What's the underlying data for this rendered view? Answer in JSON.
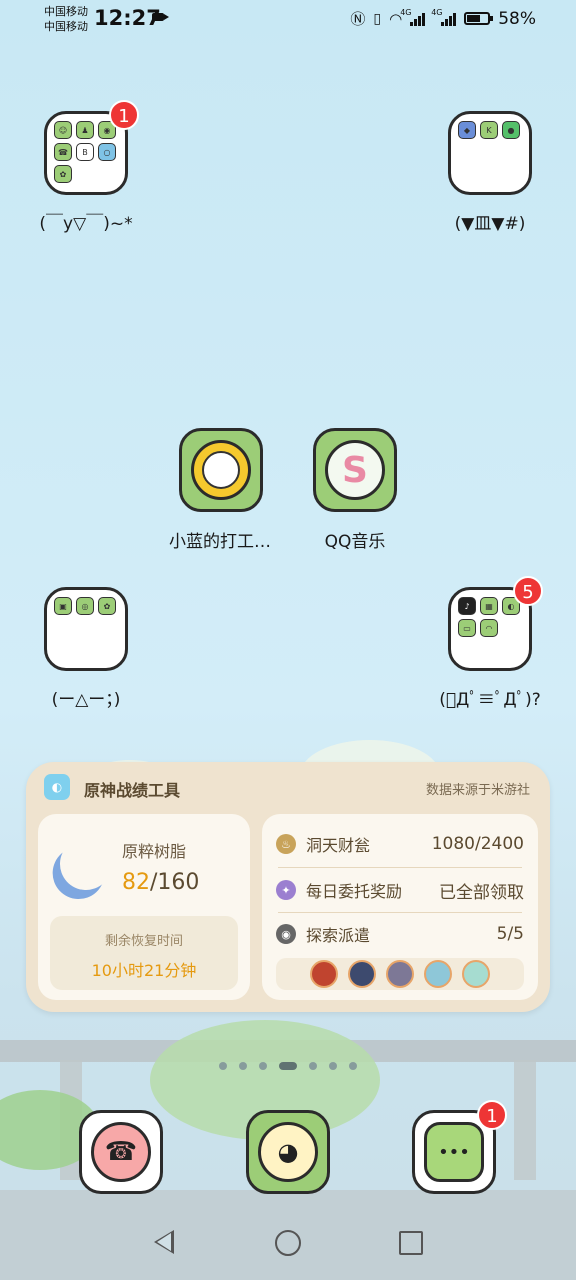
{
  "status_bar": {
    "carrier_1": "中国移动",
    "carrier_2": "中国移动",
    "time": "12:27",
    "network_1": "4G",
    "network_2": "4G",
    "battery_percent": "58%"
  },
  "folders": [
    {
      "label": "(￣y▽￣)~*",
      "badge": "1"
    },
    {
      "label": "(▼皿▼#)",
      "badge": ""
    },
    {
      "label": "(ー△ー；)",
      "badge": ""
    },
    {
      "label": "(ﾟДﾟ≡ﾟДﾟ)?",
      "badge": "5"
    }
  ],
  "apps": [
    {
      "label": "小蓝的打工…",
      "icon": "xiaolan-worker-icon"
    },
    {
      "label": "QQ音乐",
      "icon": "qq-music-icon"
    }
  ],
  "widget": {
    "title": "原神战绩工具",
    "source": "数据来源于米游社",
    "resin": {
      "label": "原粹树脂",
      "current": "82",
      "max": "/160",
      "recover_label": "剩余恢复时间",
      "recover_time": "10小时21分钟"
    },
    "stats": [
      {
        "label": "洞天财瓮",
        "value": "1080/2400"
      },
      {
        "label": "每日委托奖励",
        "value": "已全部领取"
      },
      {
        "label": "探索派遣",
        "value": "5/5"
      }
    ]
  },
  "page_indicator": {
    "pages": 7,
    "active": 3
  },
  "dock": [
    {
      "icon": "phone-icon",
      "badge": ""
    },
    {
      "icon": "camera-icon",
      "badge": ""
    },
    {
      "icon": "messages-icon",
      "badge": "1"
    }
  ],
  "colors": {
    "accent_orange": "#e59a10",
    "badge_red": "#ee3535",
    "icon_green": "#9ccd77",
    "widget_bg": "#efe3cf"
  }
}
